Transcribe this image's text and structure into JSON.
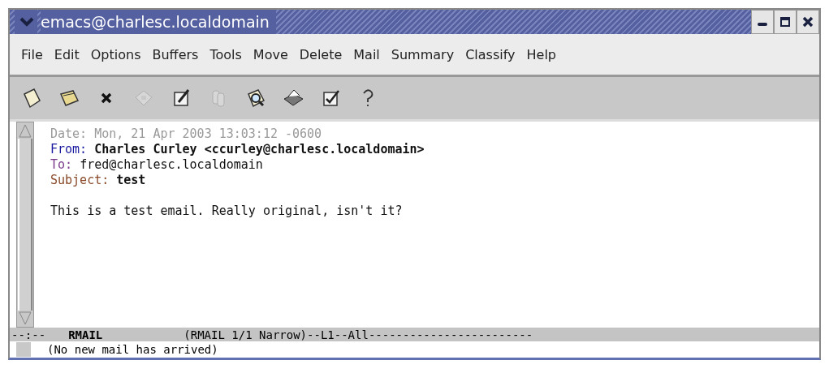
{
  "window": {
    "title": "emacs@charlesc.localdomain"
  },
  "menu": [
    "File",
    "Edit",
    "Options",
    "Buffers",
    "Tools",
    "Move",
    "Delete",
    "Mail",
    "Summary",
    "Classify",
    "Help"
  ],
  "toolbar": [
    {
      "kind": "new",
      "disabled": false
    },
    {
      "kind": "open",
      "disabled": false
    },
    {
      "kind": "close",
      "disabled": false
    },
    {
      "kind": "save",
      "disabled": true
    },
    {
      "kind": "edit",
      "disabled": false
    },
    {
      "kind": "copy",
      "disabled": true
    },
    {
      "kind": "search",
      "disabled": false
    },
    {
      "kind": "print",
      "disabled": false
    },
    {
      "kind": "spell",
      "disabled": false
    },
    {
      "kind": "help",
      "disabled": false
    }
  ],
  "headers": [
    {
      "label": "Date:",
      "value": "Mon, 21 Apr 2003 13:03:12 -0600",
      "color": "#9a9a9a",
      "bold": false,
      "dim": true
    },
    {
      "label": "From:",
      "value": "Charles Curley <ccurley@charlesc.localdomain>",
      "color": "#1a1aa0",
      "bold": true,
      "dim": false
    },
    {
      "label": "To:",
      "value": "fred@charlesc.localdomain",
      "color": "#7a3a8a",
      "bold": false,
      "dim": false
    },
    {
      "label": "Subject:",
      "value": "test",
      "color": "#8a4a2a",
      "bold": true,
      "dim": false
    }
  ],
  "body": "This is a test email. Really original, isn't it?",
  "mode_line": {
    "status": "--:--",
    "buffer": "RMAIL",
    "info": "(RMAIL 1/1 Narrow)--L1--All------------------------"
  },
  "minibuffer": "(No new mail has arrived)"
}
